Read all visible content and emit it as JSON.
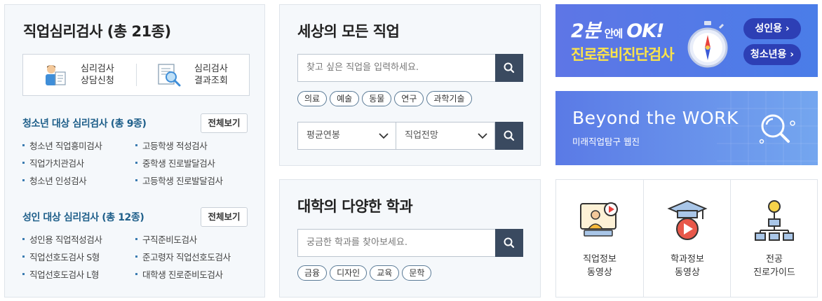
{
  "psych": {
    "title": "직업심리검사 (총 21종)",
    "quick_links": [
      {
        "line1": "심리검사",
        "line2": "상담신청",
        "icon": "counselor-icon"
      },
      {
        "line1": "심리검사",
        "line2": "결과조회",
        "icon": "document-search-icon"
      }
    ],
    "youth": {
      "heading": "청소년 대상 심리검사 (총 9종)",
      "view_all": "전체보기",
      "col1": [
        "청소년 직업흥미검사",
        "직업가치관검사",
        "청소년 인성검사"
      ],
      "col2": [
        "고등학생 적성검사",
        "중학생 진로발달검사",
        "고등학생 진로발달검사"
      ]
    },
    "adult": {
      "heading": "성인 대상 심리검사 (총 12종)",
      "view_all": "전체보기",
      "col1": [
        "성인용 직업적성검사",
        "직업선호도검사 S형",
        "직업선호도검사 L형"
      ],
      "col2": [
        "구직준비도검사",
        "준고령자 직업선호도검사",
        "대학생 진로준비도검사"
      ]
    }
  },
  "jobs": {
    "title": "세상의 모든 직업",
    "search_placeholder": "찾고 싶은 직업을 입력하세요.",
    "tags": [
      "의료",
      "예술",
      "동물",
      "연구",
      "과학기술"
    ],
    "select_salary": "평균연봉",
    "select_outlook": "직업전망"
  },
  "majors": {
    "title": "대학의 다양한 학과",
    "search_placeholder": "궁금한 학과를 찾아보세요.",
    "tags": [
      "금융",
      "디자인",
      "교육",
      "문학"
    ]
  },
  "banner1": {
    "big": "2분",
    "small": "안에",
    "ok": "OK!",
    "line2": "진로준비진단검사",
    "adult_btn": "성인용 ›",
    "youth_btn": "청소년용 ›"
  },
  "banner2": {
    "title": "Beyond the WORK",
    "subtitle": "미래직업탐구 웹진"
  },
  "videos": [
    {
      "line1": "직업정보",
      "line2": "동영상",
      "icon": "job-video-icon"
    },
    {
      "line1": "학과정보",
      "line2": "동영상",
      "icon": "major-video-icon"
    },
    {
      "line1": "전공",
      "line2": "진로가이드",
      "icon": "org-chart-icon"
    }
  ],
  "colors": {
    "accent_navy": "#3a4a60",
    "heading_blue": "#1f5f8a",
    "banner_yellow": "#fbe34a",
    "pill_blue": "#2d3fb5"
  }
}
